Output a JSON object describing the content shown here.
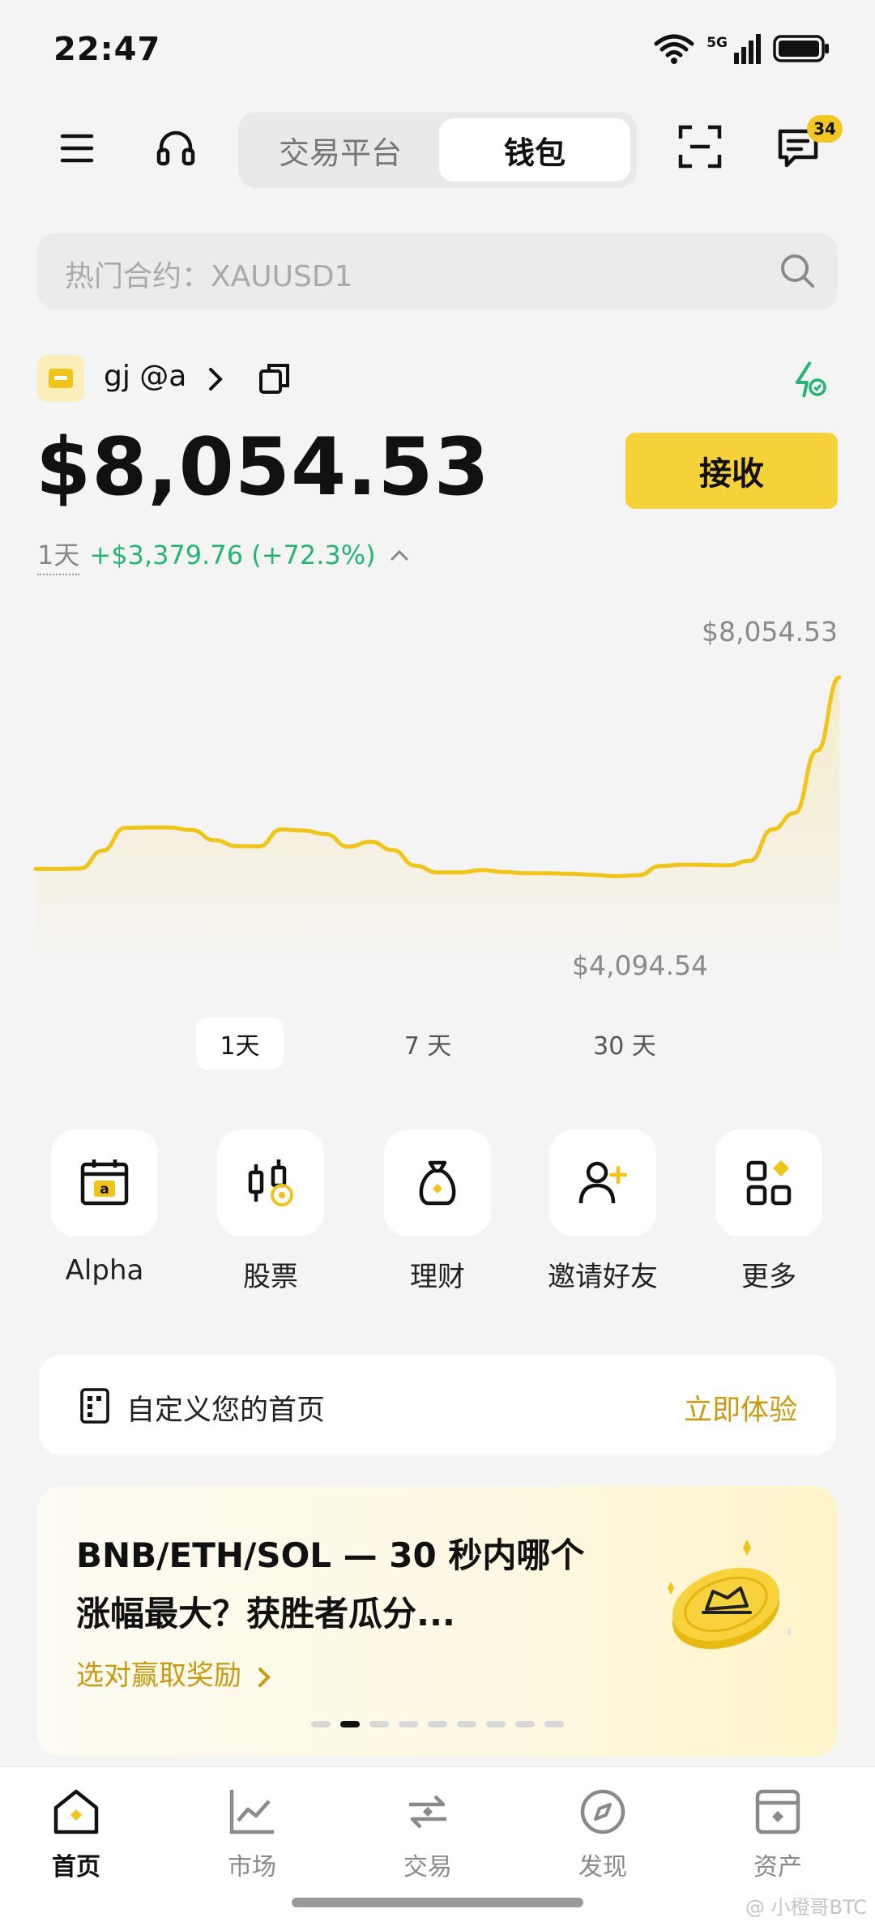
{
  "status_bar": {
    "time": "22:47",
    "network": "5G"
  },
  "header": {
    "menu_icon": "menu-icon",
    "support_icon": "headset-icon",
    "tabs": [
      {
        "label": "交易平台",
        "active": false
      },
      {
        "label": "钱包",
        "active": true
      }
    ],
    "scan_icon": "scan-icon",
    "messages_icon": "message-icon",
    "messages_badge": "34"
  },
  "search": {
    "placeholder": "热门合约：XAUUSD1"
  },
  "account": {
    "name": "gj @a",
    "balance": "$8,054.53",
    "receive_label": "接收",
    "period": "1天",
    "change": "+$3,379.76 (+72.3%)"
  },
  "chart_data": {
    "type": "line",
    "high_label": "$8,054.53",
    "low_label": "$4,094.54",
    "ylim": [
      4094.54,
      8054.53
    ],
    "values": [
      5165,
      5165,
      5172,
      5440,
      5785,
      5790,
      5790,
      5750,
      5600,
      5510,
      5505,
      5760,
      5745,
      5690,
      5500,
      5575,
      5450,
      5215,
      5112,
      5112,
      5148,
      5118,
      5100,
      5100,
      5090,
      5075,
      5055,
      5070,
      5210,
      5230,
      5225,
      5220,
      5290,
      5760,
      6010,
      6950,
      8054.53
    ],
    "color": "#f0c419"
  },
  "ranges": [
    {
      "label": "1天",
      "active": true
    },
    {
      "label": "7 天",
      "active": false
    },
    {
      "label": "30 天",
      "active": false
    }
  ],
  "quick_actions": [
    {
      "label": "Alpha",
      "icon": "calendar-alpha-icon"
    },
    {
      "label": "股票",
      "icon": "candlestick-coin-icon"
    },
    {
      "label": "理财",
      "icon": "money-bag-icon"
    },
    {
      "label": "邀请好友",
      "icon": "add-user-icon"
    },
    {
      "label": "更多",
      "icon": "grid-more-icon"
    }
  ],
  "customize": {
    "text": "自定义您的首页",
    "link": "立即体验"
  },
  "promo": {
    "line1": "BNB/ETH/SOL — 30 秒内哪个",
    "line2": "涨幅最大？获胜者瓜分...",
    "link": "选对赢取奖励",
    "slides": 9,
    "active_slide": 2
  },
  "bottom_nav": [
    {
      "label": "首页",
      "icon": "home-icon",
      "active": true
    },
    {
      "label": "市场",
      "icon": "market-chart-icon",
      "active": false
    },
    {
      "label": "交易",
      "icon": "trade-swap-icon",
      "active": false
    },
    {
      "label": "发现",
      "icon": "discover-compass-icon",
      "active": false
    },
    {
      "label": "资产",
      "icon": "wallet-assets-icon",
      "active": false
    }
  ],
  "watermark": "@ 小橙哥BTC",
  "colors": {
    "accent": "#f6d23a",
    "positive": "#27b376",
    "link": "#c99a12"
  }
}
